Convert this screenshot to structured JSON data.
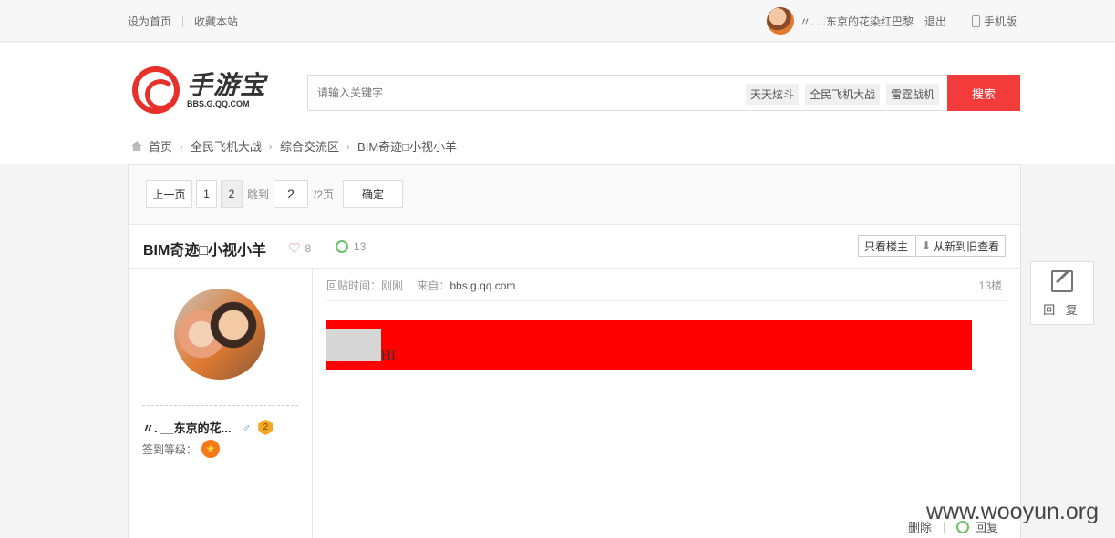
{
  "topbar": {
    "set_home": "设为首页",
    "bookmark": "收藏本站",
    "username": "〃. ...东京的花染红巴黎",
    "logout": "退出",
    "mobile": "手机版"
  },
  "header": {
    "logo_text": "手游宝",
    "logo_sub": "BBS.G.QQ.COM",
    "search_placeholder": "请输入关键字",
    "hot_tags": [
      "天天炫斗",
      "全民飞机大战",
      "雷霆战机"
    ],
    "search_button": "搜索"
  },
  "breadcrumb": [
    "首页",
    "全民飞机大战",
    "综合交流区",
    "BIM奇迹□小视小羊"
  ],
  "pager": {
    "prev": "上一页",
    "pages": [
      "1",
      "2"
    ],
    "jump_label": "跳到",
    "jump_value": "2",
    "total": "/2页",
    "confirm": "确定"
  },
  "thread": {
    "title": "BIM奇迹□小视小羊",
    "likes": "8",
    "comments": "13",
    "only_author": "只看楼主",
    "order": "从新到旧查看"
  },
  "author": {
    "name": "〃. __东京的花...",
    "gender_symbol": "♂",
    "level": "2",
    "sign_label": "签到等级："
  },
  "post": {
    "time": "回贴时间：刚刚",
    "source_label": "来自：",
    "source_link": "bbs.g.qq.com",
    "floor": "13楼",
    "content_text": "HI",
    "delete": "删除",
    "reply": "回复"
  },
  "reply_float": {
    "label": "回 复"
  },
  "watermark": "www.wooyun.org",
  "colors": {
    "accent": "#f33b3b",
    "content_bg": "#ff0000"
  }
}
